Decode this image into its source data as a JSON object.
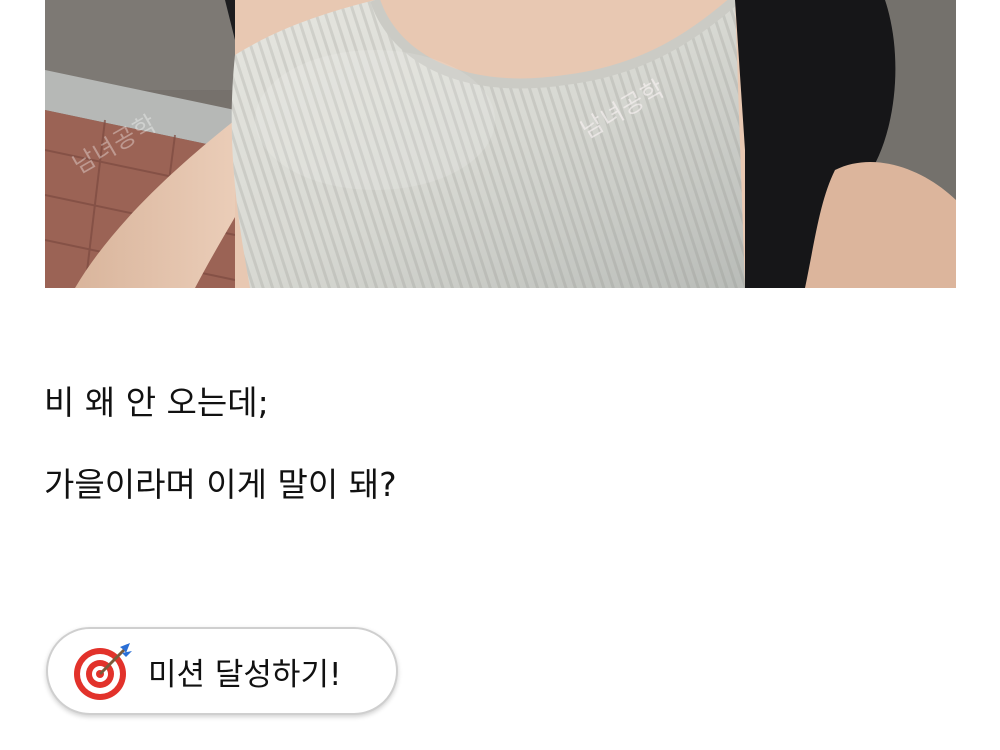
{
  "photo": {
    "watermark_center": "남녀공학",
    "watermark_left": "남녀공학",
    "icon": "photo-image"
  },
  "post": {
    "lines": [
      "비 왜 안 오는데;",
      "가을이라며 이게 말이 돼?"
    ]
  },
  "mission_button": {
    "label": "미션 달성하기!",
    "icon": "target-dart-icon"
  },
  "colors": {
    "background": "#ffffff",
    "text": "#111111",
    "button_border": "#cfcfcf",
    "target_red": "#e2322b"
  }
}
